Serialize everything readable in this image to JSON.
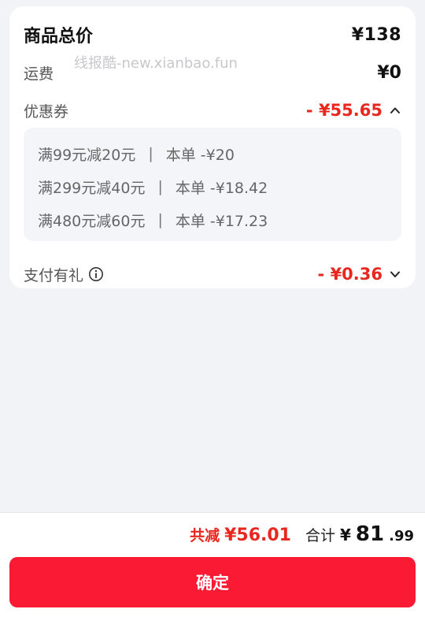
{
  "order": {
    "subtotal_label": "商品总价",
    "subtotal_value": "¥138",
    "shipping_label": "运费",
    "shipping_value": "¥0",
    "watermark": "线报酷-new.xianbao.fun",
    "coupon_label": "优惠券",
    "coupon_value": "- ¥55.65",
    "coupons": [
      {
        "rule": "满99元减20元",
        "sep": "|",
        "applied": "本单 -¥20"
      },
      {
        "rule": "满299元减40元",
        "sep": "|",
        "applied": "本单 -¥18.42"
      },
      {
        "rule": "满480元减60元",
        "sep": "|",
        "applied": "本单 -¥17.23"
      }
    ],
    "gift_label": "支付有礼",
    "gift_value": "- ¥0.36"
  },
  "footer": {
    "saved_label": "共减",
    "saved_value": "¥56.01",
    "total_label": "合计",
    "total_currency": "¥",
    "total_int": "81",
    "total_dec": ".99",
    "confirm_label": "确定"
  },
  "colors": {
    "accent": "#fb1a33",
    "discount": "#e8271f",
    "background": "#f2f3f7"
  },
  "icons": {
    "coupon_toggle": "chevron-up-icon",
    "gift_toggle": "chevron-down-icon",
    "gift_info": "info-icon"
  }
}
